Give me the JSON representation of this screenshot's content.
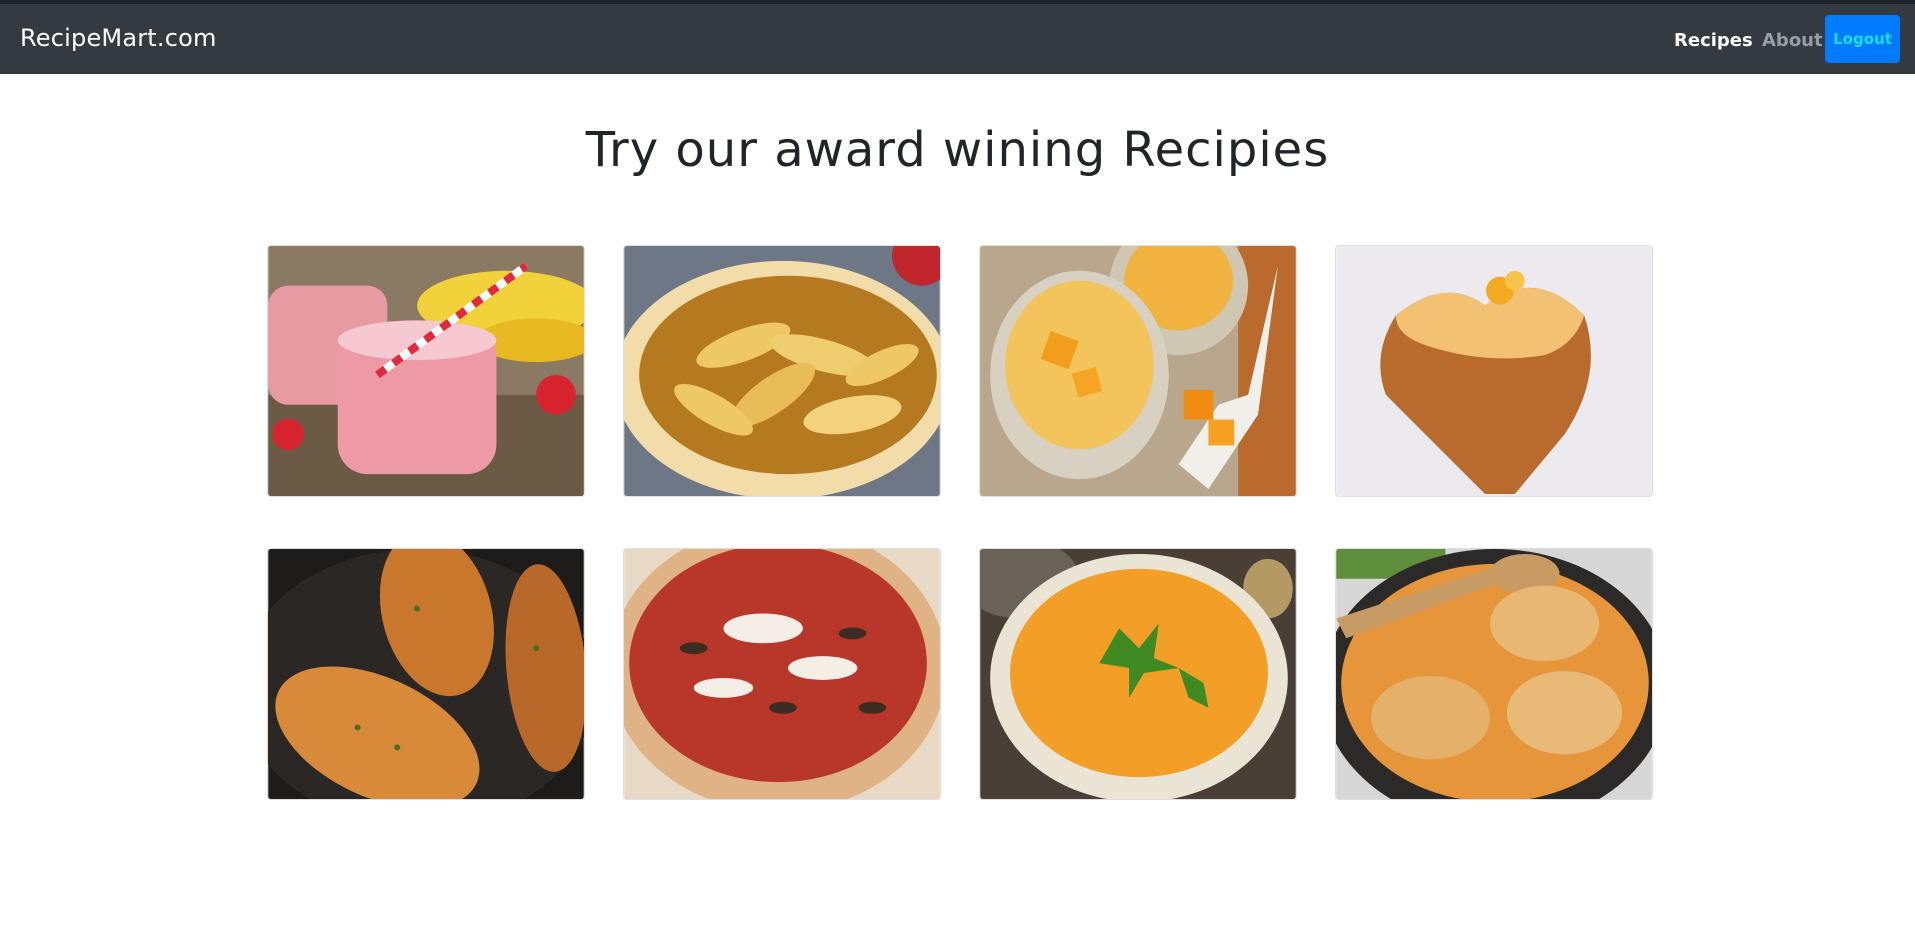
{
  "navbar": {
    "brand": "RecipeMart.com",
    "links": [
      "Recipes",
      "About"
    ],
    "logout_label": "Logout",
    "background": "#343a40",
    "logout_color": "#007bff"
  },
  "main": {
    "heading": "Try our award wining Recipies"
  },
  "recipes": [
    {
      "icon": "strawberry-smoothie-photo"
    },
    {
      "icon": "apple-pie-photo"
    },
    {
      "icon": "mango-dessert-photo"
    },
    {
      "icon": "heart-cake-photo"
    },
    {
      "icon": "grilled-chicken-photo"
    },
    {
      "icon": "pizza-photo"
    },
    {
      "icon": "pumpkin-soup-photo"
    },
    {
      "icon": "creamy-chicken-photo"
    }
  ]
}
